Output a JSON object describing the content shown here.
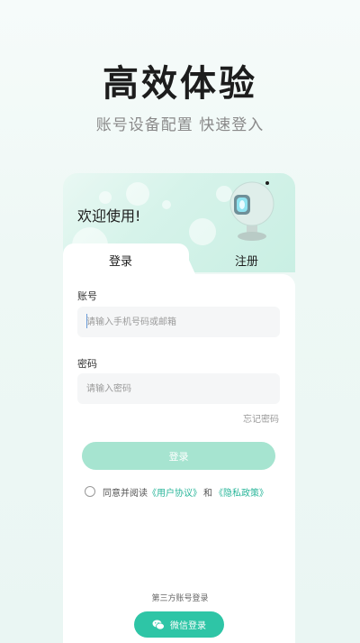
{
  "hero": {
    "title": "高效体验",
    "subtitle": "账号设备配置 快速登入"
  },
  "card": {
    "welcome": "欢迎使用!"
  },
  "tabs": {
    "login": "登录",
    "register": "注册"
  },
  "form": {
    "account_label": "账号",
    "account_placeholder": "请输入手机号码或邮箱",
    "password_label": "密码",
    "password_placeholder": "请输入密码",
    "forgot": "忘记密码",
    "login_button": "登录"
  },
  "agreement": {
    "prefix": "同意并阅读",
    "user_agreement": "《用户协议》",
    "and": "和",
    "privacy_policy": "《隐私政策》"
  },
  "third_party": {
    "title": "第三方账号登录",
    "wechat_button": "微信登录"
  },
  "colors": {
    "accent": "#2ec5a6",
    "button_disabled": "#a6e4d0"
  }
}
